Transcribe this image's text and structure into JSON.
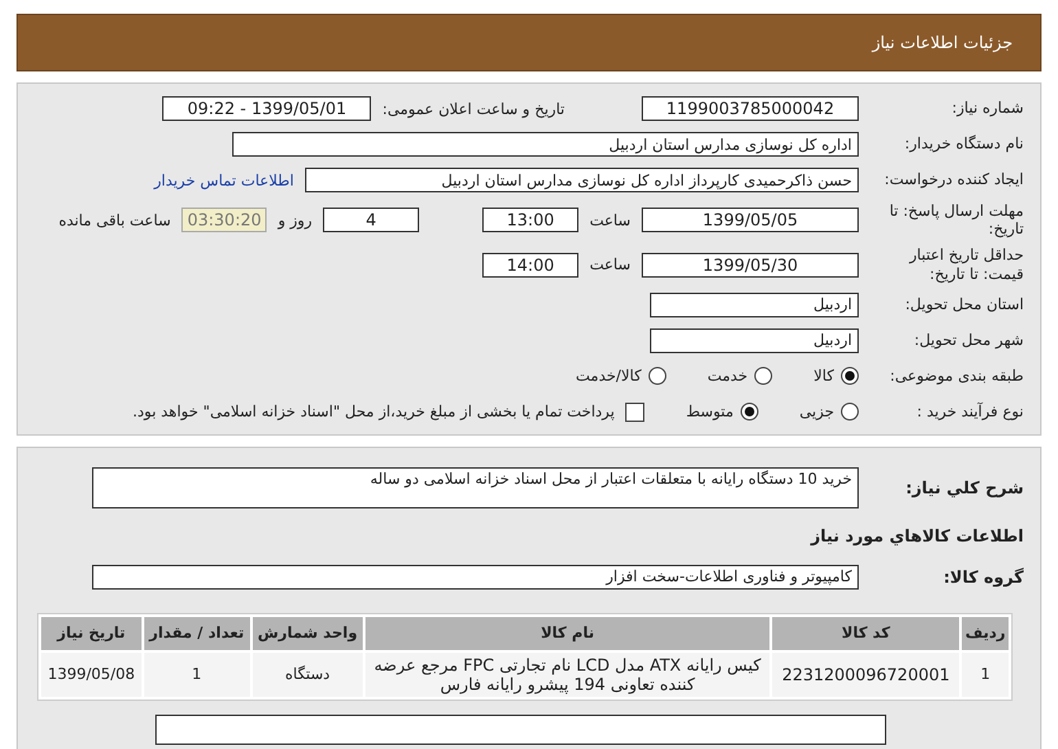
{
  "header": {
    "title": "جزئیات اطلاعات نیاز"
  },
  "details": {
    "need_number": {
      "label": "شماره نیاز:",
      "value": "1199003785000042"
    },
    "announce": {
      "label": "تاریخ و ساعت اعلان عمومی:",
      "value": "1399/05/01 - 09:22"
    },
    "buyer": {
      "label": "نام دستگاه خریدار:",
      "value": "اداره کل نوسازی مدارس استان اردبیل"
    },
    "creator": {
      "label": "ایجاد کننده درخواست:",
      "value": "حسن ذاکرحمیدی کارپرداز اداره کل نوسازی مدارس استان اردبیل",
      "link": "اطلاعات تماس خریدار"
    },
    "deadline": {
      "label": "مهلت ارسال پاسخ: تا تاریخ:",
      "date": "1399/05/05",
      "time_label": "ساعت",
      "time": "13:00",
      "days": "4",
      "days_label": "روز و",
      "remaining": "03:30:20",
      "remaining_label": "ساعت باقی مانده"
    },
    "validity": {
      "label": "حداقل تاریخ اعتبار قیمت: تا تاریخ:",
      "date": "1399/05/30",
      "time_label": "ساعت",
      "time": "14:00"
    },
    "province": {
      "label": "استان محل تحویل:",
      "value": "اردبیل"
    },
    "city": {
      "label": "شهر محل تحویل:",
      "value": "اردبیل"
    },
    "category": {
      "label": "طبقه بندی موضوعی:",
      "options": [
        {
          "label": "کالا",
          "selected": true
        },
        {
          "label": "خدمت",
          "selected": false
        },
        {
          "label": "کالا/خدمت",
          "selected": false
        }
      ]
    },
    "process": {
      "label": "نوع فرآیند خرید :",
      "options": [
        {
          "label": "جزیی",
          "selected": false
        },
        {
          "label": "متوسط",
          "selected": true
        }
      ],
      "treasury": {
        "label": "پرداخت تمام یا بخشی از مبلغ خرید،از محل \"اسناد خزانه اسلامی\" خواهد بود.",
        "checked": false
      }
    }
  },
  "needs": {
    "description": {
      "label": "شرح کلي نياز:",
      "value": "خرید 10 دستگاه رایانه با متعلقات اعتبار از محل اسناد خزانه اسلامی دو ساله"
    },
    "goods_heading": "اطلاعات کالاهاي مورد نياز",
    "group": {
      "label": "گروه کالا:",
      "value": "کامپیوتر و فناوری اطلاعات-سخت افزار"
    },
    "table": {
      "columns": [
        "ردیف",
        "کد کالا",
        "نام کالا",
        "واحد شمارش",
        "تعداد / مقدار",
        "تاریخ نیاز"
      ],
      "rows": [
        [
          "1",
          "2231200096720001",
          "کیس رایانه ATX مدل LCD نام تجارتی FPC مرجع عرضه کننده تعاونی 194 پیشرو رایانه فارس",
          "دستگاه",
          "1",
          "1399/05/08"
        ]
      ]
    }
  }
}
